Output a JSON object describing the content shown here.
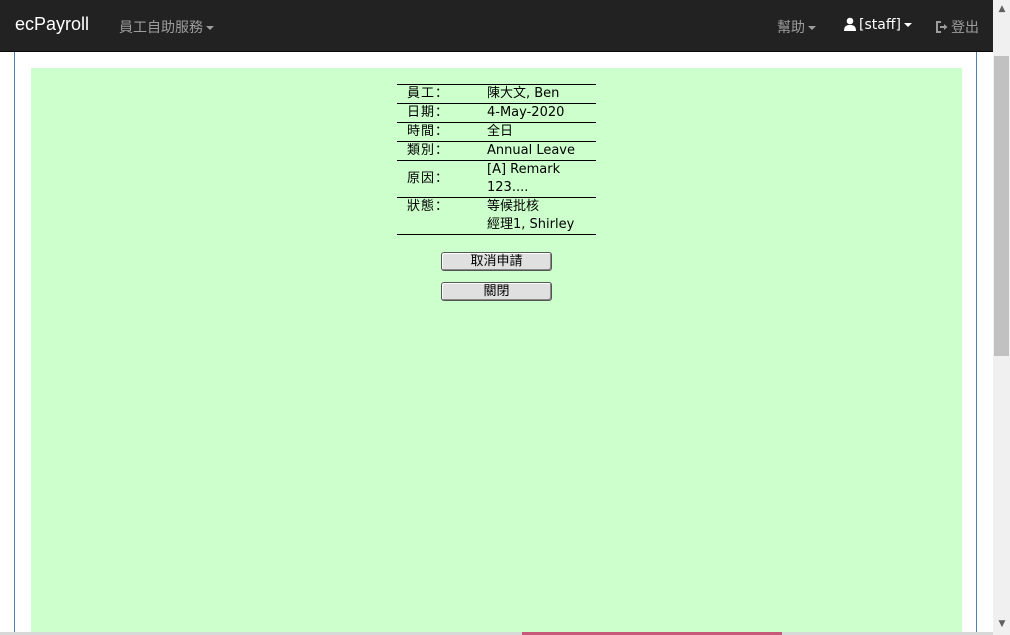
{
  "navbar": {
    "brand": "ecPayroll",
    "menu_self_service": "員工自助服務",
    "menu_help": "幫助",
    "menu_user": "[staff]",
    "menu_logout": "登出"
  },
  "details": {
    "rows": [
      {
        "label": "員工：",
        "value": "陳大文, Ben"
      },
      {
        "label": "日期：",
        "value": "4-May-2020"
      },
      {
        "label": "時間：",
        "value": "全日"
      },
      {
        "label": "類別：",
        "value": "Annual Leave"
      },
      {
        "label": "原因：",
        "value_line1": "[A] Remark",
        "value_line2": "123...."
      },
      {
        "label": "狀態：",
        "value_line1": "等候批核",
        "value_line2": "經理1, Shirley"
      }
    ]
  },
  "buttons": {
    "cancel_application": "取消申請",
    "close": "關閉"
  },
  "colors": {
    "navbar_bg": "#222222",
    "content_bg": "#ccffcc",
    "frame_border": "#4f7fb5"
  },
  "icons": {
    "user": "user-icon",
    "logout": "logout-icon",
    "scroll_up": "scroll-up-arrow-icon",
    "scroll_down": "scroll-down-arrow-icon"
  }
}
